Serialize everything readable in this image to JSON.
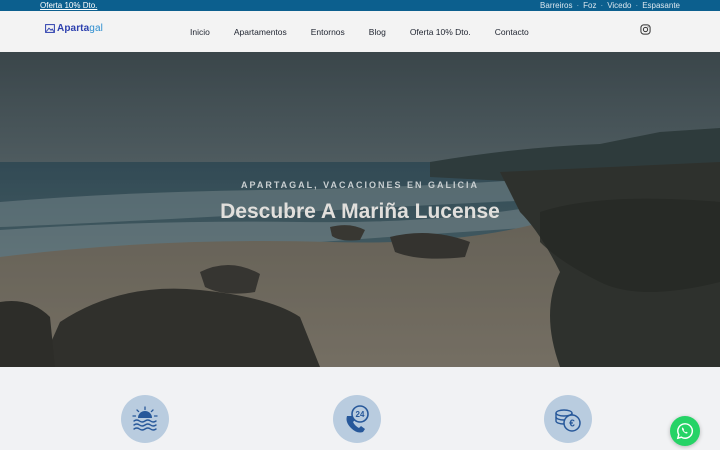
{
  "topbar": {
    "offer_link": "Oferta 10% Dto.",
    "towns": [
      "Barreiros",
      "Foz",
      "Vicedo",
      "Espasante"
    ]
  },
  "header": {
    "logo": {
      "part1": "Aparta",
      "part2": "gal"
    },
    "nav": [
      "Inicio",
      "Apartamentos",
      "Entornos",
      "Blog",
      "Oferta 10% Dto.",
      "Contacto"
    ],
    "social_icon": "instagram-icon"
  },
  "hero": {
    "kicker": "APARTAGAL, VACACIONES EN GALICIA",
    "title": "Descubre A Mariña Lucense"
  },
  "features": {
    "icons": [
      "sunset-sea-icon",
      "phone-24h-icon",
      "euro-coins-icon"
    ]
  },
  "floating": {
    "icon": "whatsapp-icon"
  },
  "colors": {
    "topbar": "#0c5f8e",
    "brand_dark": "#2c3fae",
    "brand_light": "#2d8ed0",
    "feature_circle": "#b9ccdf",
    "whatsapp": "#25d366"
  }
}
